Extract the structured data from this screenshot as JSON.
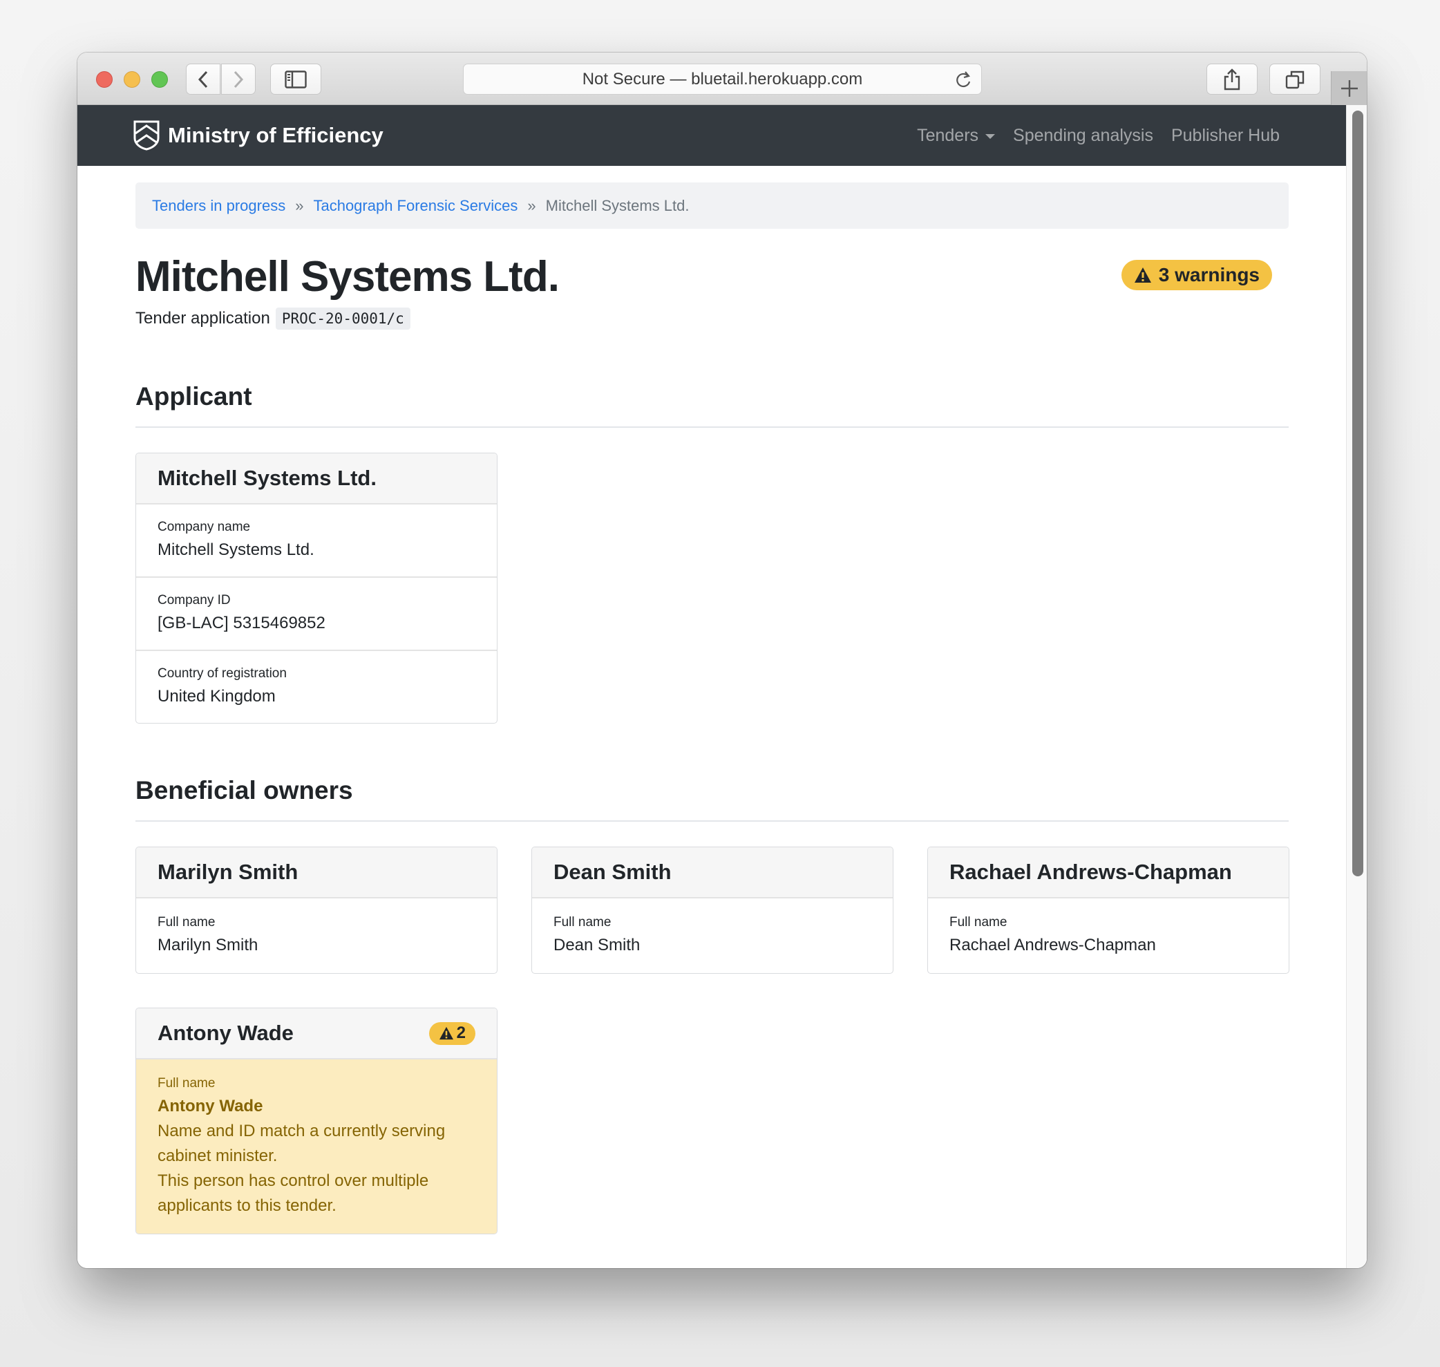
{
  "browser": {
    "url_text": "Not Secure — bluetail.herokuapp.com",
    "icons": {
      "back": "chevron-left-icon",
      "forward": "chevron-right-icon",
      "sidebar": "sidebar-icon",
      "reload": "reload-icon",
      "share": "share-icon",
      "tabs": "tabs-overview-icon",
      "new_tab": "plus-icon"
    }
  },
  "navbar": {
    "brand": "Ministry of Efficiency",
    "brand_icon": "shield-icon",
    "links": [
      {
        "label": "Tenders",
        "dropdown": true
      },
      {
        "label": "Spending analysis",
        "dropdown": false
      },
      {
        "label": "Publisher Hub",
        "dropdown": false
      }
    ]
  },
  "breadcrumb": {
    "items": [
      "Tenders in progress",
      "Tachograph Forensic Services",
      "Mitchell Systems Ltd."
    ],
    "separator": "»"
  },
  "page": {
    "title": "Mitchell Systems Ltd.",
    "subtitle_label": "Tender application",
    "application_id": "PROC-20-0001/c",
    "warnings_badge": "3 warnings"
  },
  "applicant": {
    "heading": "Applicant",
    "card_title": "Mitchell Systems Ltd.",
    "fields": [
      {
        "label": "Company name",
        "value": "Mitchell Systems Ltd."
      },
      {
        "label": "Company ID",
        "value": "[GB-LAC] 5315469852"
      },
      {
        "label": "Country of registration",
        "value": "United Kingdom"
      }
    ]
  },
  "owners": {
    "heading": "Beneficial owners",
    "cards": [
      {
        "title": "Marilyn Smith",
        "field_label": "Full name",
        "field_value": "Marilyn Smith"
      },
      {
        "title": "Dean Smith",
        "field_label": "Full name",
        "field_value": "Dean Smith"
      },
      {
        "title": "Rachael Andrews-Chapman",
        "field_label": "Full name",
        "field_value": "Rachael Andrews-Chapman"
      },
      {
        "title": "Antony Wade",
        "warning_count": "2",
        "field_label": "Full name",
        "field_value": "Antony Wade",
        "warnings": [
          "Name and ID match a currently serving cabinet minister.",
          "This person has control over multiple applicants to this tender."
        ]
      }
    ]
  },
  "colors": {
    "navbar_bg": "#343a40",
    "link": "#2a7be4",
    "warning_badge": "#f4c243",
    "warning_bg": "#fcecbf",
    "warning_text": "#856404"
  }
}
